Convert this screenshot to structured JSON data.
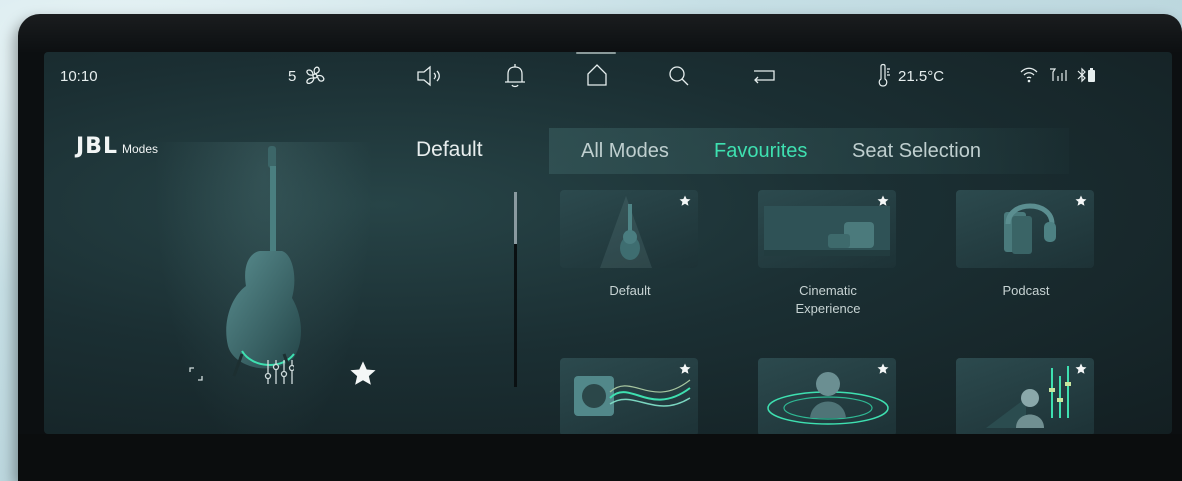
{
  "status": {
    "time": "10:10",
    "fan_level": "5",
    "temperature": "21.5°C",
    "icons": [
      "fan-icon",
      "volume-icon",
      "bell-icon",
      "home-icon",
      "search-icon",
      "return-icon",
      "thermometer-icon",
      "wifi-icon",
      "signal-icon",
      "bluetooth-battery-icon"
    ]
  },
  "brand": {
    "logo": "JBL",
    "subtitle": "Modes"
  },
  "current_mode": "Default",
  "tabs": [
    {
      "label": "All Modes",
      "active": false
    },
    {
      "label": "Favourites",
      "active": true
    },
    {
      "label": "Seat Selection",
      "active": false
    }
  ],
  "modes": [
    {
      "label": "Default",
      "icon": "guitar-icon"
    },
    {
      "label": "Cinematic Experience",
      "label_line1": "Cinematic",
      "label_line2": "Experience",
      "icon": "theater-icon"
    },
    {
      "label": "Podcast",
      "icon": "headphones-icon"
    },
    {
      "label": "",
      "icon": "speaker-wave-icon"
    },
    {
      "label": "",
      "icon": "surround-person-icon"
    },
    {
      "label": "",
      "icon": "equalizer-person-icon"
    }
  ],
  "colors": {
    "accent": "#3ee0b0",
    "text": "#e6eeee",
    "screen": "#1b2f33"
  }
}
